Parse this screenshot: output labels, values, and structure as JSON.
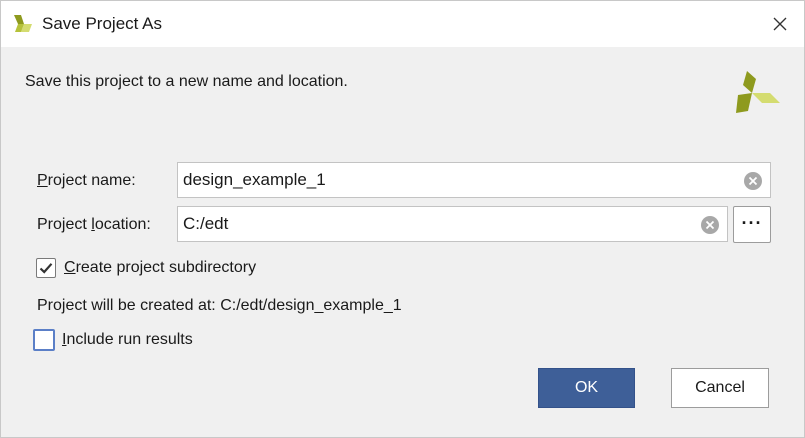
{
  "window": {
    "title": "Save Project As",
    "title_icon": "app-logo-icon",
    "close_icon": "close-icon"
  },
  "description": "Save this project to a new name and location.",
  "brand_icon": "brand-logo-icon",
  "project_name": {
    "label_prefix": "",
    "label_mnemonic": "P",
    "label_rest": "roject name:",
    "value": "design_example_1"
  },
  "project_location": {
    "label_prefix": "Project ",
    "label_mnemonic": "l",
    "label_rest": "ocation:",
    "value": "C:/edt",
    "browse_label": "···"
  },
  "create_subdirectory": {
    "label_mnemonic": "C",
    "label_rest": "reate project subdirectory",
    "checked": true
  },
  "created_at_text": "Project will be created at: C:/edt/design_example_1",
  "include_run_results": {
    "label_mnemonic": "I",
    "label_rest": "nclude run results",
    "checked": false
  },
  "buttons": {
    "ok_label": "OK",
    "cancel_label": "Cancel"
  },
  "colors": {
    "accent": "#3e5f98",
    "focus_ring": "#5b7fc7",
    "logo_olive": "#8e9a1e",
    "logo_light": "#d4dc70"
  }
}
